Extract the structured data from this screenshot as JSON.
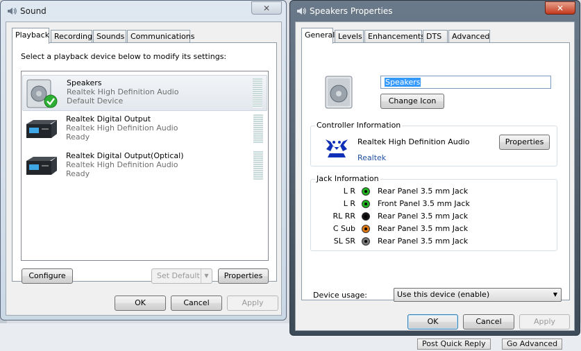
{
  "background": {
    "post_quick_reply": "Post Quick Reply",
    "go_advanced": "Go Advanced"
  },
  "sound_window": {
    "title": "Sound",
    "close": "✕",
    "tabs": [
      "Playback",
      "Recording",
      "Sounds",
      "Communications"
    ],
    "instruction": "Select a playback device below to modify its settings:",
    "devices": [
      {
        "name": "Speakers",
        "line1": "Realtek High Definition Audio",
        "line2": "Default Device"
      },
      {
        "name": "Realtek Digital Output",
        "line1": "Realtek High Definition Audio",
        "line2": "Ready"
      },
      {
        "name": "Realtek Digital Output(Optical)",
        "line1": "Realtek High Definition Audio",
        "line2": "Ready"
      }
    ],
    "configure": "Configure",
    "set_default": "Set Default",
    "properties": "Properties",
    "ok": "OK",
    "cancel": "Cancel",
    "apply": "Apply"
  },
  "props_window": {
    "title": "Speakers Properties",
    "close": "✕",
    "tabs": [
      "General",
      "Levels",
      "Enhancements",
      "DTS",
      "Advanced"
    ],
    "device_name": "Speakers",
    "change_icon": "Change Icon",
    "controller_title": "Controller Information",
    "controller_name": "Realtek High Definition Audio",
    "controller_vendor": "Realtek",
    "controller_properties": "Properties",
    "jack_title": "Jack Information",
    "jacks": [
      {
        "code": "L R",
        "desc": "Rear Panel 3.5 mm Jack",
        "color": "#1fb51f"
      },
      {
        "code": "L R",
        "desc": "Front Panel 3.5 mm Jack",
        "color": "#1fb51f"
      },
      {
        "code": "RL RR",
        "desc": "Rear Panel 3.5 mm Jack",
        "color": "#111111"
      },
      {
        "code": "C Sub",
        "desc": "Rear Panel 3.5 mm Jack",
        "color": "#e07a10"
      },
      {
        "code": "SL SR",
        "desc": "Rear Panel 3.5 mm Jack",
        "color": "#7a7a7a"
      }
    ],
    "device_usage_label": "Device usage:",
    "device_usage_value": "Use this device (enable)",
    "ok": "OK",
    "cancel": "Cancel",
    "apply": "Apply"
  }
}
